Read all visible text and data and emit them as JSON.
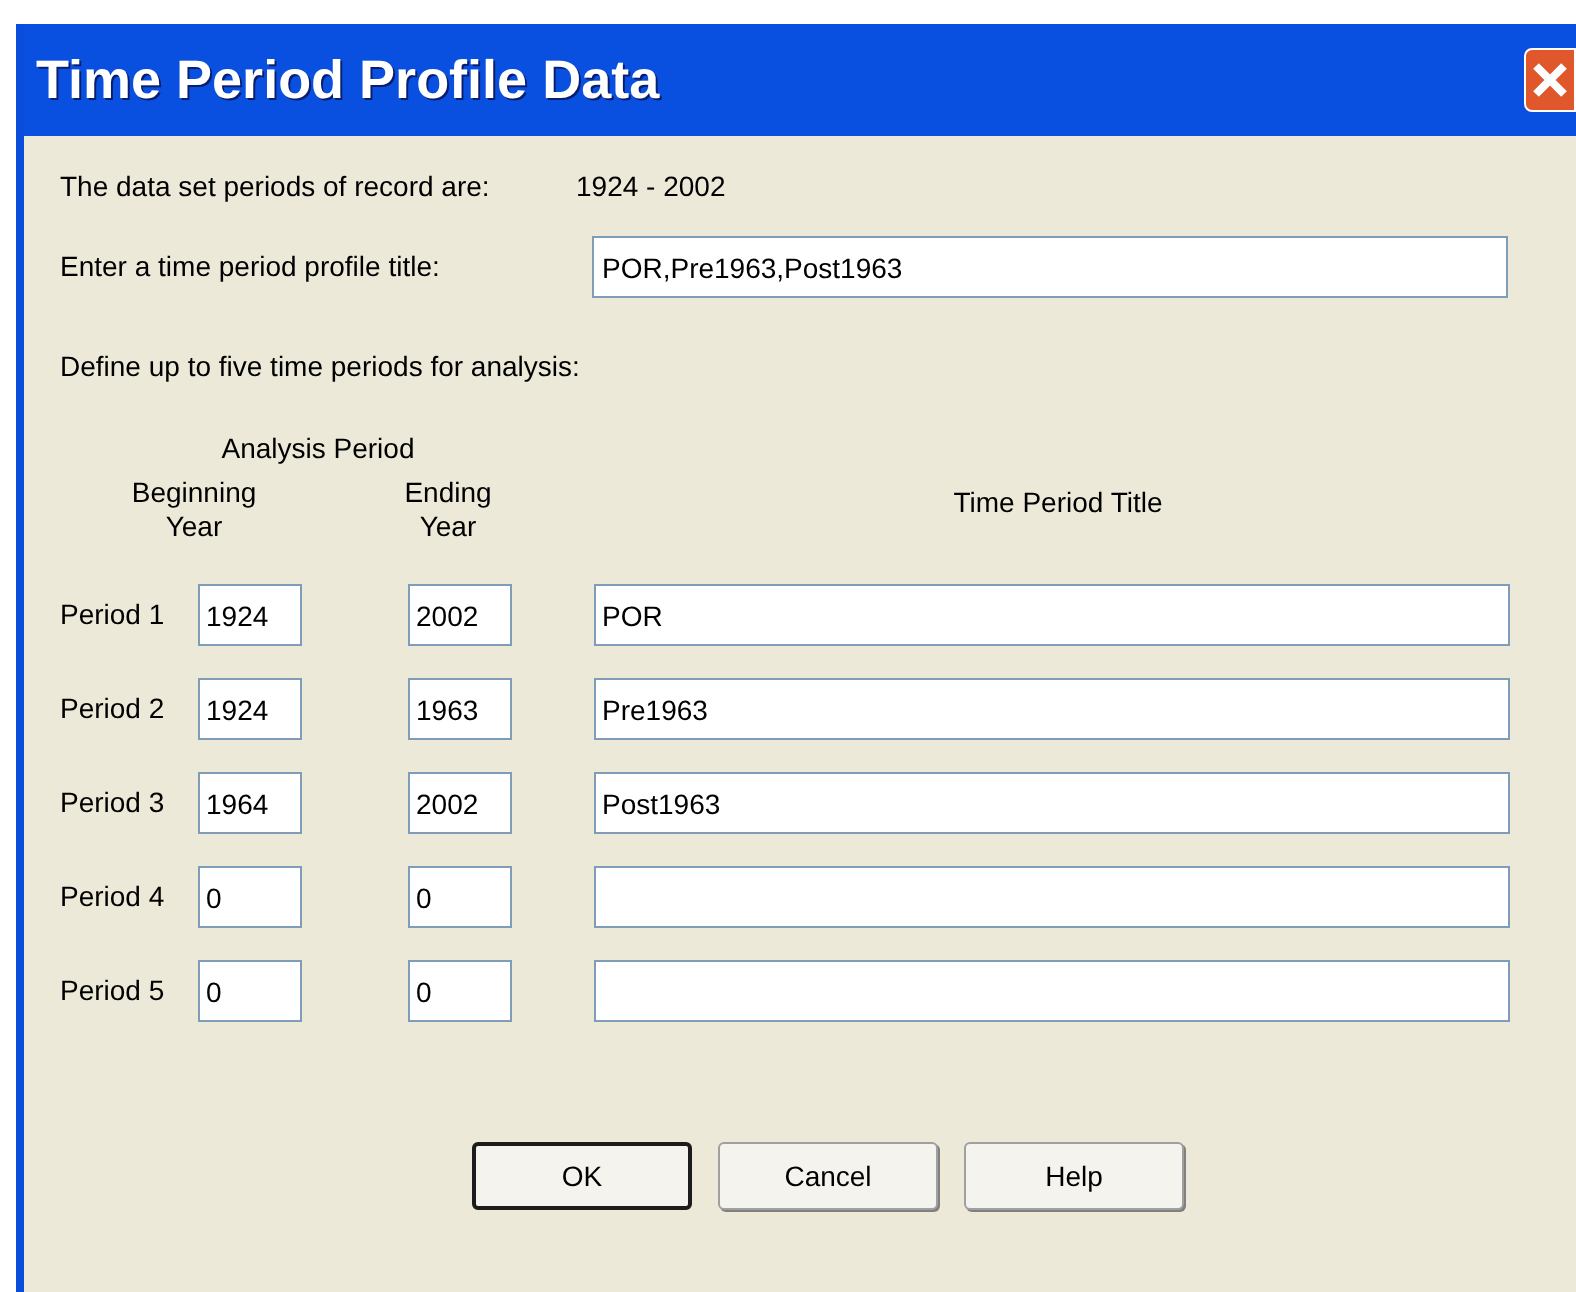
{
  "window": {
    "title": "Time Period Profile Data"
  },
  "record_label": "The data set periods of record are:",
  "record_value": "1924 - 2002",
  "profile_title": {
    "label": "Enter a time period profile title:",
    "value": "POR,Pre1963,Post1963"
  },
  "instructions": "Define up to five time periods for analysis:",
  "headers": {
    "group": "Analysis Period",
    "begin": [
      "Beginning",
      "Year"
    ],
    "end": [
      "Ending",
      "Year"
    ],
    "title": "Time Period Title"
  },
  "periods": [
    {
      "label": "Period 1",
      "begin": "1924",
      "end": "2002",
      "title": "POR"
    },
    {
      "label": "Period 2",
      "begin": "1924",
      "end": "1963",
      "title": "Pre1963"
    },
    {
      "label": "Period 3",
      "begin": "1964",
      "end": "2002",
      "title": "Post1963"
    },
    {
      "label": "Period 4",
      "begin": "0",
      "end": "0"
    },
    {
      "label": "Period 5",
      "begin": "0",
      "end": "0"
    }
  ],
  "buttons": [
    {
      "label": "OK",
      "default": true
    },
    {
      "label": "Cancel",
      "default": false
    },
    {
      "label": "Help",
      "default": false
    }
  ]
}
